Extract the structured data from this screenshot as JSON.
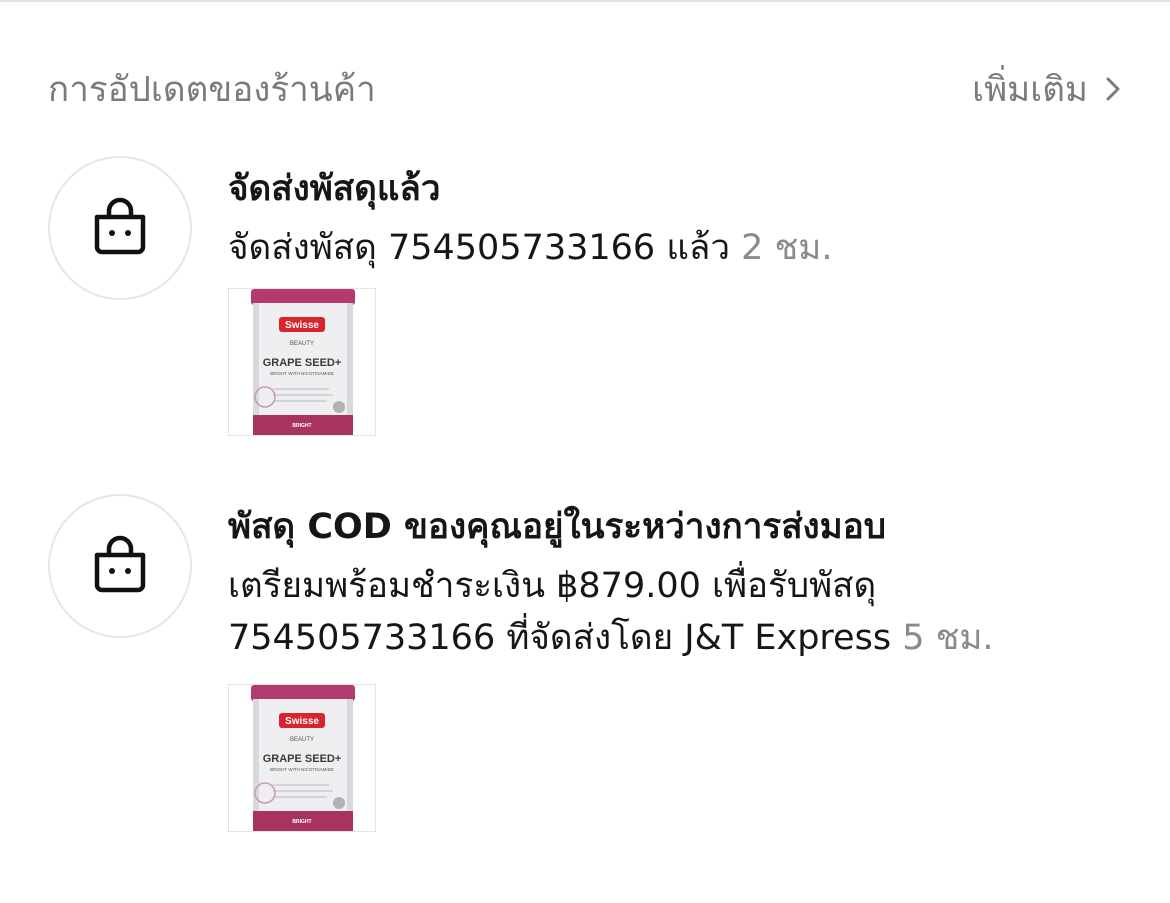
{
  "section": {
    "title": "การอัปเดตของร้านค้า",
    "more_label": "เพิ่มเติม"
  },
  "updates": [
    {
      "icon": "shopping-bag-icon",
      "title": "จัดส่งพัสดุแล้ว",
      "body": "จัดส่งพัสดุ 754505733166 แล้ว",
      "time": "2 ชม.",
      "product": {
        "brand": "Swisse",
        "line": "BEAUTY",
        "name": "GRAPE SEED+",
        "tagline": "BRIGHT WITH NICOTINAMIDE",
        "variant": "BRIGHT"
      }
    },
    {
      "icon": "shopping-bag-icon",
      "title": "พัสดุ COD ของคุณอยู่ในระหว่างการส่งมอบ",
      "body": "เตรียมพร้อมชำระเงิน ฿879.00 เพื่อรับพัสดุ 754505733166 ที่จัดส่งโดย J&T Express",
      "time": "5 ชม.",
      "product": {
        "brand": "Swisse",
        "line": "BEAUTY",
        "name": "GRAPE SEED+",
        "tagline": "BRIGHT WITH NICOTINAMIDE",
        "variant": "BRIGHT"
      }
    }
  ],
  "colors": {
    "product_cap": "#b23a6e",
    "product_band": "#a8335f",
    "brand_badge": "#d8242c"
  }
}
